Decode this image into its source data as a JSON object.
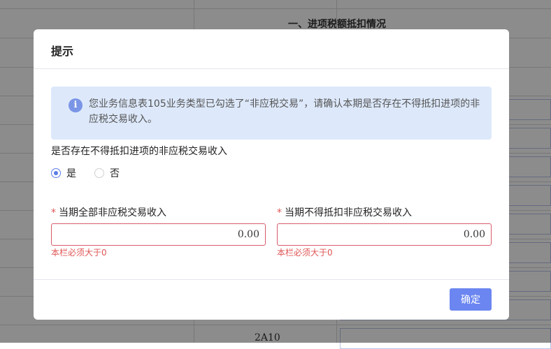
{
  "background": {
    "section_title": "一、进项税额抵扣情况",
    "row_code": "2A10"
  },
  "dialog": {
    "title": "提示",
    "alert": {
      "icon": "info-icon",
      "icon_glyph": "i",
      "message": "您业务信息表105业务类型已勾选了“非应税交易”，请确认本期是否存在不得抵扣进项的非应税交易收入。"
    },
    "question": "是否存在不得抵扣进项的非应税交易收入",
    "options": [
      {
        "label": "是",
        "selected": true
      },
      {
        "label": "否",
        "selected": false
      }
    ],
    "fields": [
      {
        "required_mark": "*",
        "label": "当期全部非应税交易收入",
        "value": "0.00",
        "error": "本栏必须大于0"
      },
      {
        "required_mark": "*",
        "label": "当期不得抵扣非应税交易收入",
        "value": "0.00",
        "error": "本栏必须大于0"
      }
    ],
    "confirm_label": "确定"
  },
  "colors": {
    "accent": "#6b86f0",
    "alert_bg": "#dde9fb",
    "error": "#e05555",
    "mask": "rgba(0,0,0,0.45)"
  }
}
